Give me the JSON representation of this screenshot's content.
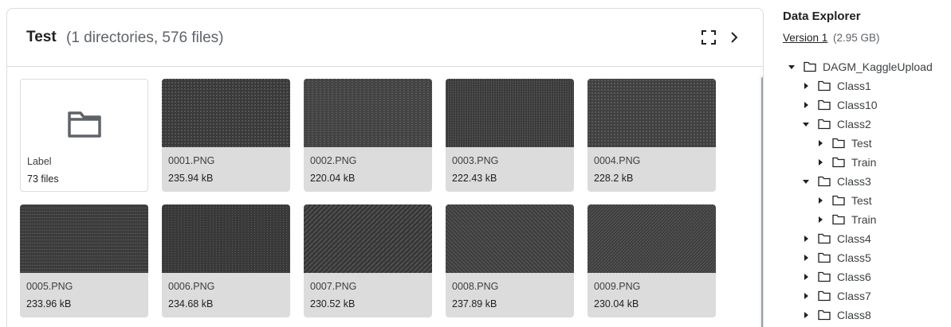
{
  "panel": {
    "title": "Test",
    "subtitle": "(1 directories, 576 files)"
  },
  "folder_card": {
    "name": "Label",
    "count": "73 files",
    "icon": "folder-icon"
  },
  "files": [
    {
      "name": "0001.PNG",
      "size": "235.94 kB"
    },
    {
      "name": "0002.PNG",
      "size": "220.04 kB"
    },
    {
      "name": "0003.PNG",
      "size": "222.43 kB"
    },
    {
      "name": "0004.PNG",
      "size": "228.2 kB"
    },
    {
      "name": "0005.PNG",
      "size": "233.96 kB"
    },
    {
      "name": "0006.PNG",
      "size": "234.68 kB"
    },
    {
      "name": "0007.PNG",
      "size": "230.52 kB"
    },
    {
      "name": "0008.PNG",
      "size": "237.89 kB"
    },
    {
      "name": "0009.PNG",
      "size": "230.04 kB"
    }
  ],
  "explorer": {
    "title": "Data Explorer",
    "version_link": "Version 1",
    "version_size": "(2.95 GB)",
    "tree": [
      {
        "label": "DAGM_KaggleUpload",
        "depth": 0,
        "expanded": true
      },
      {
        "label": "Class1",
        "depth": 1,
        "expanded": false
      },
      {
        "label": "Class10",
        "depth": 1,
        "expanded": false
      },
      {
        "label": "Class2",
        "depth": 1,
        "expanded": true
      },
      {
        "label": "Test",
        "depth": 2,
        "expanded": false
      },
      {
        "label": "Train",
        "depth": 2,
        "expanded": false
      },
      {
        "label": "Class3",
        "depth": 1,
        "expanded": true
      },
      {
        "label": "Test",
        "depth": 2,
        "expanded": false
      },
      {
        "label": "Train",
        "depth": 2,
        "expanded": false
      },
      {
        "label": "Class4",
        "depth": 1,
        "expanded": false
      },
      {
        "label": "Class5",
        "depth": 1,
        "expanded": false
      },
      {
        "label": "Class6",
        "depth": 1,
        "expanded": false
      },
      {
        "label": "Class7",
        "depth": 1,
        "expanded": false
      },
      {
        "label": "Class8",
        "depth": 1,
        "expanded": false
      }
    ]
  },
  "colors": {
    "thumb_bg": "#3d3d3d",
    "info_bg": "#dcdcdc",
    "border": "#dadce0"
  }
}
